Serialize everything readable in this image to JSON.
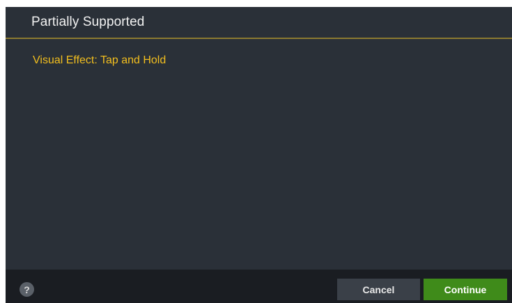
{
  "dialog": {
    "title": "Partially Supported",
    "message": "Visual Effect: Tap and Hold"
  },
  "footer": {
    "help_glyph": "?",
    "help_icon": "question-mark-icon",
    "cancel_label": "Cancel",
    "continue_label": "Continue"
  },
  "colors": {
    "dialog_bg": "#2a3038",
    "footer_bg": "#1a1d22",
    "header_divider": "#8c7a30",
    "message_text": "#f2be1e",
    "continue_bg": "#3f8b1a",
    "cancel_bg": "#3a4048"
  }
}
